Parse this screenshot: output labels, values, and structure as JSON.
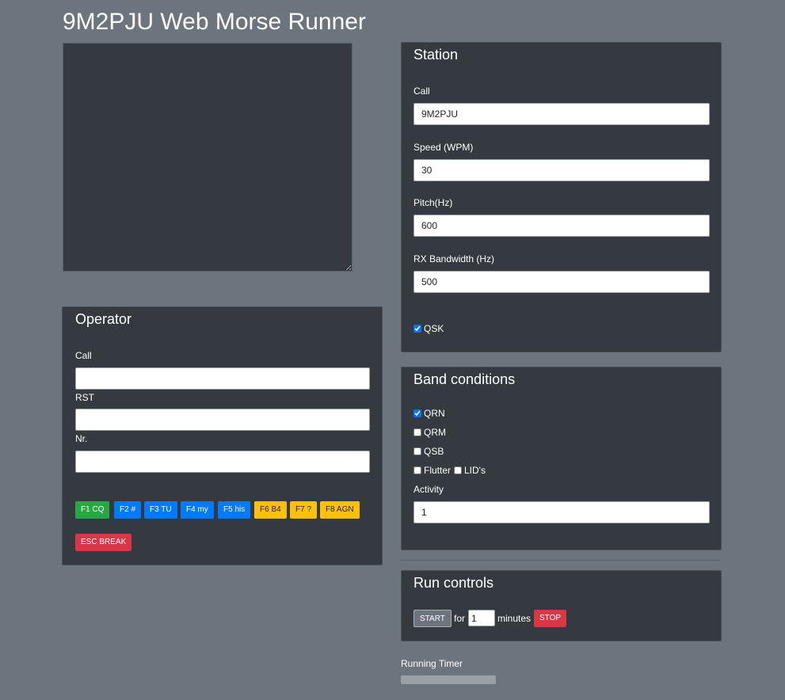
{
  "app": {
    "title": "9M2PJU Web Morse Runner"
  },
  "log": {
    "value": ""
  },
  "station": {
    "heading": "Station",
    "call_label": "Call",
    "call_value": "9M2PJU",
    "speed_label": "Speed (WPM)",
    "speed_value": "30",
    "pitch_label": "Pitch(Hz)",
    "pitch_value": "600",
    "bandwidth_label": "RX Bandwidth (Hz)",
    "bandwidth_value": "500",
    "qsk_label": "QSK",
    "qsk_checked": true
  },
  "operator": {
    "heading": "Operator",
    "call_label": "Call",
    "call_value": "",
    "rst_label": "RST",
    "rst_value": "",
    "nr_label": "Nr.",
    "nr_value": "",
    "keys": {
      "f1": "F1 CQ",
      "f2": "F2 #",
      "f3": "F3 TU",
      "f4": "F4 my",
      "f5": "F5 his",
      "f6": "F6 B4",
      "f7": "F7 ?",
      "f8": "F8 AGN",
      "esc": "ESC BREAK"
    }
  },
  "band": {
    "heading": "Band conditions",
    "qrn_label": "QRN",
    "qrn_checked": true,
    "qrm_label": "QRM",
    "qrm_checked": false,
    "qsb_label": "QSB",
    "qsb_checked": false,
    "flutter_label": "Flutter",
    "flutter_checked": false,
    "lids_label": "LID's",
    "lids_checked": false,
    "activity_label": "Activity",
    "activity_value": "1"
  },
  "run": {
    "heading": "Run controls",
    "start_label": "START",
    "for_label": "for",
    "minutes_value": "1",
    "minutes_label": "minutes",
    "stop_label": "STOP"
  },
  "timer": {
    "label": "Running Timer",
    "progress": 0
  }
}
